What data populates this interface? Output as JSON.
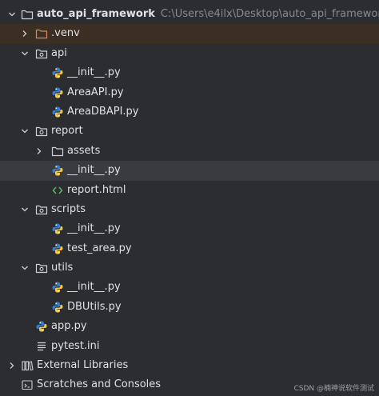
{
  "project_tree": {
    "root": {
      "label": "auto_api_framework",
      "path": "C:\\Users\\e4ilx\\Desktop\\auto_api_framework"
    },
    "venv": {
      "label": ".venv"
    },
    "api": {
      "label": "api",
      "files": [
        "__init__.py",
        "AreaAPI.py",
        "AreaDBAPI.py"
      ]
    },
    "report": {
      "label": "report",
      "assets": "assets",
      "files": [
        "__init__.py",
        "report.html"
      ]
    },
    "scripts": {
      "label": "scripts",
      "files": [
        "__init__.py",
        "test_area.py"
      ]
    },
    "utils": {
      "label": "utils",
      "files": [
        "__init__.py",
        "DBUtils.py"
      ]
    },
    "root_files": [
      "app.py",
      "pytest.ini"
    ],
    "external_libraries": "External Libraries",
    "scratches": "Scratches and Consoles"
  },
  "watermark": "CSDN @楠神说软件测试",
  "icons": {
    "collapsed": "chevron-right-icon",
    "expanded": "chevron-down-icon",
    "folder": "folder-icon",
    "package": "package-folder-icon",
    "python": "python-file-icon",
    "html": "html-file-icon",
    "ini": "text-file-icon",
    "libraries": "library-icon",
    "scratches": "scratches-icon"
  },
  "colors": {
    "background": "#2b2d30",
    "text": "#dfe1e5",
    "path": "#868a91",
    "excluded_row": "#3b2e22",
    "excluded_folder": "#d9885f",
    "selected_row": "#393b40",
    "python_blue": "#3f7ec7",
    "python_yellow": "#f2c744",
    "html_green": "#5fb867"
  }
}
